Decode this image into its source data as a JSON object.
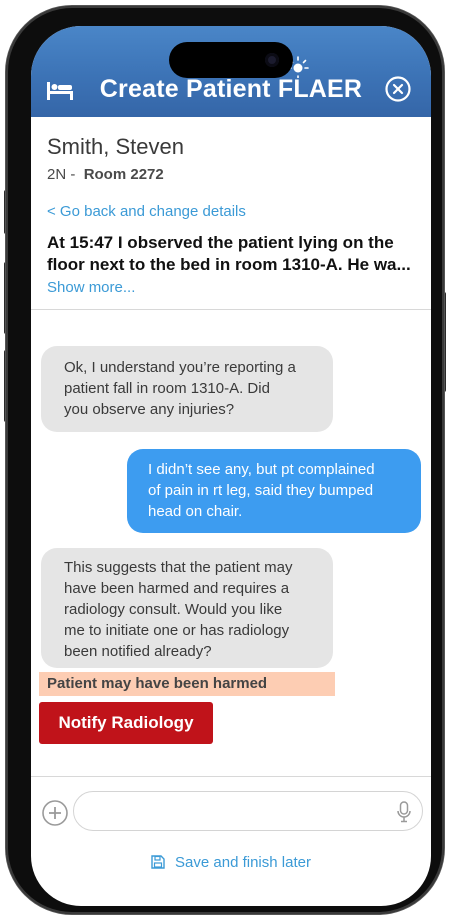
{
  "header": {
    "title": "Create Patient FLAER"
  },
  "patient": {
    "name": "Smith, Steven",
    "unit": "2N -",
    "room": "Room 2272"
  },
  "back_link": "< Go back and change details",
  "observation": {
    "line1": "At 15:47 I observed the patient lying on the",
    "line2": "floor next to the bed in room 1310-A.  He wa..."
  },
  "show_more": "Show more...",
  "chat": {
    "messages": [
      {
        "from": "assistant",
        "lines": [
          "Ok, I understand you’re reporting a",
          "patient fall in room 1310-A.  Did",
          "you observe any injuries?"
        ]
      },
      {
        "from": "user",
        "lines": [
          "I didn’t see any, but pt complained",
          "of pain in rt leg, said they bumped",
          "head on chair."
        ]
      },
      {
        "from": "assistant",
        "lines": [
          "This suggests that the patient may",
          "have been harmed and requires a",
          "radiology consult. Would you like",
          "me to initiate one or has radiology",
          "been notified already?"
        ]
      }
    ]
  },
  "warning": "Patient may have been harmed",
  "notify_button": "Notify Radiology",
  "composer": {
    "placeholder": ""
  },
  "save_label": "Save and finish later",
  "colors": {
    "header": "#3c73b6",
    "accent": "#3b9ad6",
    "user_bubble": "#3d9cf0",
    "danger": "#c0131a",
    "warning_bg": "#fdcdb3"
  }
}
